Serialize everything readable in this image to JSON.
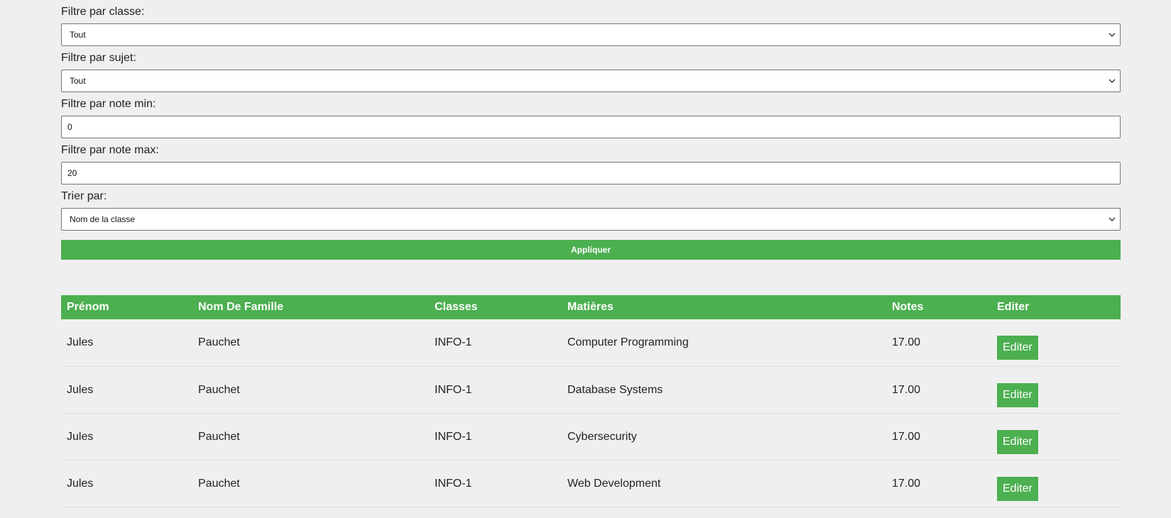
{
  "filters": {
    "classe_label": "Filtre par classe:",
    "classe_value": "Tout",
    "sujet_label": "Filtre par sujet:",
    "sujet_value": "Tout",
    "note_min_label": "Filtre par note min:",
    "note_min_value": "0",
    "note_max_label": "Filtre par note max:",
    "note_max_value": "20",
    "trier_label": "Trier par:",
    "trier_value": "Nom de la classe",
    "apply_label": "Appliquer"
  },
  "table": {
    "headers": [
      "Prénom",
      "Nom De Famille",
      "Classes",
      "Matières",
      "Notes",
      "Editer"
    ],
    "rows": [
      {
        "prenom": "Jules",
        "nom": "Pauchet",
        "classe": "INFO-1",
        "matiere": "Computer Programming",
        "note": "17.00",
        "edit": "Editer"
      },
      {
        "prenom": "Jules",
        "nom": "Pauchet",
        "classe": "INFO-1",
        "matiere": "Database Systems",
        "note": "17.00",
        "edit": "Editer"
      },
      {
        "prenom": "Jules",
        "nom": "Pauchet",
        "classe": "INFO-1",
        "matiere": "Cybersecurity",
        "note": "17.00",
        "edit": "Editer"
      },
      {
        "prenom": "Jules",
        "nom": "Pauchet",
        "classe": "INFO-1",
        "matiere": "Web Development",
        "note": "17.00",
        "edit": "Editer"
      }
    ]
  },
  "colors": {
    "accent": "#4caf50",
    "background": "#efefef"
  },
  "icons": {
    "select_arrow": "chevron-down-icon"
  }
}
